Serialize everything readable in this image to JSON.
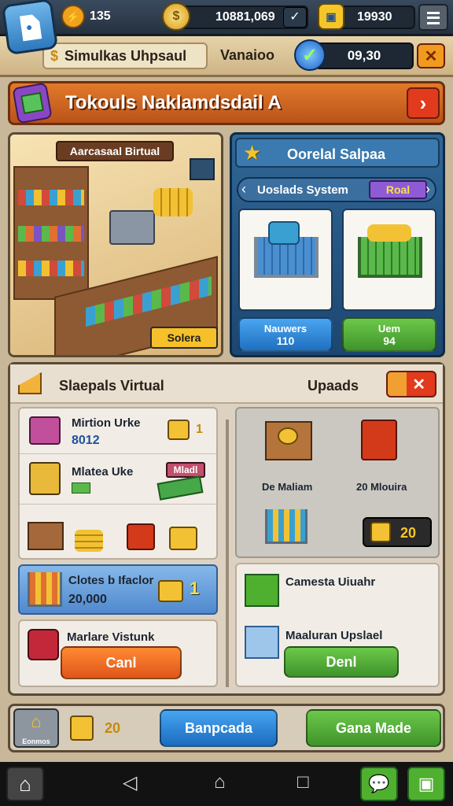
{
  "topbar": {
    "energy": "135",
    "coins": "10881,069",
    "gems": "19930"
  },
  "subbar": {
    "mode": "Simulkas Uhpsaul",
    "version_label": "Vanaioo",
    "timer": "09,30"
  },
  "title": {
    "text": "Tokouls Naklamdsdail A"
  },
  "store": {
    "label": "Aarcasaal Birtual",
    "tag": "Solera"
  },
  "overlay": {
    "title": "Oorelal Salpaa",
    "system": "Uoslads System",
    "badge": "Roal",
    "card1_label": "Nauwers",
    "card1_value": "110",
    "card2_label": "Uem",
    "card2_value": "94"
  },
  "lower": {
    "title": "Slaepals Virtual",
    "uploads": "Upaads",
    "items": [
      {
        "name": "Mirtion Urke",
        "value": "8012",
        "extra": "1"
      },
      {
        "name": "Mlatea Uke",
        "tag": "Mladl"
      }
    ],
    "promo": {
      "name": "Clotes b Ifaclor",
      "value": "20,000",
      "extra": "1"
    },
    "market": {
      "name": "Marlare Vistunk",
      "button": "Canl"
    },
    "grid": {
      "label1": "De Maliam",
      "label2": "20 Mlouira",
      "count": "20"
    },
    "capsule": {
      "name": "Camesta Uiuahr"
    },
    "makeup": {
      "name": "Maaluran Upslael",
      "button": "Denl"
    }
  },
  "bottom": {
    "home_label": "Eonmos",
    "count": "20",
    "primary": "Banpcada",
    "secondary": "Gana Made"
  },
  "colors": {
    "accent": "#e2792a",
    "blue": "#2f7fd0",
    "green": "#4fb02f",
    "red": "#d23a1a"
  }
}
